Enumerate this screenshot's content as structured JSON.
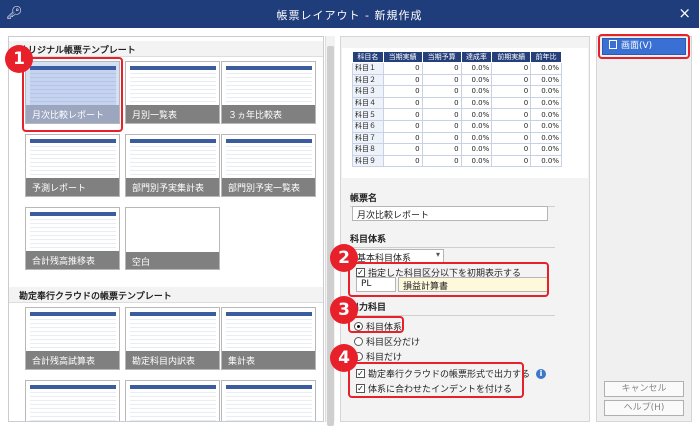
{
  "window": {
    "title": "帳票レイアウト - 新規作成",
    "logo_icon": "key-search-icon",
    "close": "×"
  },
  "left": {
    "section1_title": "オリジナル帳票テンプレート",
    "section2_title": "勘定奉行クラウドの帳票テンプレート",
    "templates1": [
      "月次比較レポート",
      "月別一覧表",
      "３ヵ年比較表",
      "予測レポート",
      "部門別予実集計表",
      "部門別予実一覧表",
      "合計残高推移表",
      "空白"
    ],
    "templates2": [
      "合計残高試算表",
      "勘定科目内訳表",
      "集計表"
    ]
  },
  "preview": {
    "headers": [
      "科目名",
      "当期実績",
      "当期予算",
      "達成率",
      "前期実績",
      "前年比"
    ],
    "rows": [
      [
        "科目１",
        "0",
        "0",
        "0.0%",
        "0",
        "0.0%"
      ],
      [
        "科目２",
        "0",
        "0",
        "0.0%",
        "0",
        "0.0%"
      ],
      [
        "科目３",
        "0",
        "0",
        "0.0%",
        "0",
        "0.0%"
      ],
      [
        "科目４",
        "0",
        "0",
        "0.0%",
        "0",
        "0.0%"
      ],
      [
        "科目５",
        "0",
        "0",
        "0.0%",
        "0",
        "0.0%"
      ],
      [
        "科目６",
        "0",
        "0",
        "0.0%",
        "0",
        "0.0%"
      ],
      [
        "科目７",
        "0",
        "0",
        "0.0%",
        "0",
        "0.0%"
      ],
      [
        "科目８",
        "0",
        "0",
        "0.0%",
        "0",
        "0.0%"
      ],
      [
        "科目９",
        "0",
        "0",
        "0.0%",
        "0",
        "0.0%"
      ]
    ]
  },
  "form": {
    "name_label": "帳票名",
    "name_value": "月次比較レポート",
    "account_label": "科目体系",
    "account_value": "基本科目体系",
    "initial_check": "指定した科目区分以下を初期表示する",
    "code_value": "PL",
    "code_name": "損益計算書",
    "output_label": "出力科目",
    "radio1": "科目体系",
    "radio2": "科目区分だけ",
    "radio3": "科目だけ",
    "check_kanjo": "勘定奉行クラウドの帳票形式で出力する",
    "check_indent": "体系に合わせたインデントを付ける"
  },
  "buttons": {
    "screen": "画面(V)",
    "cancel": "キャンセル",
    "help": "ヘルプ(H)"
  },
  "badges": [
    "1",
    "2",
    "3",
    "4"
  ],
  "colors": {
    "title_bar": "#1f3d7a",
    "highlight": "#e8202a",
    "primary": "#3a6fd3"
  }
}
